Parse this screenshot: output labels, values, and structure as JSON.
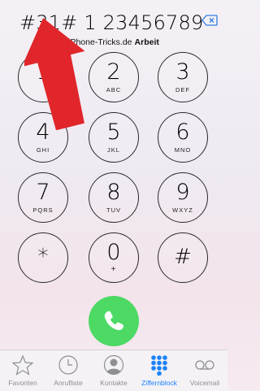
{
  "dialer": {
    "number": "#31# 1 23456789",
    "caller_name": "iPhone-Tricks.de",
    "caller_tag": "Arbeit"
  },
  "keys": [
    {
      "digit": "1",
      "letters": ""
    },
    {
      "digit": "2",
      "letters": "ABC"
    },
    {
      "digit": "3",
      "letters": "DEF"
    },
    {
      "digit": "4",
      "letters": "GHI"
    },
    {
      "digit": "5",
      "letters": "JKL"
    },
    {
      "digit": "6",
      "letters": "MNO"
    },
    {
      "digit": "7",
      "letters": "PQRS"
    },
    {
      "digit": "8",
      "letters": "TUV"
    },
    {
      "digit": "9",
      "letters": "WXYZ"
    },
    {
      "digit": "*",
      "letters": ""
    },
    {
      "digit": "0",
      "letters": "+"
    },
    {
      "digit": "#",
      "letters": ""
    }
  ],
  "tabbar": {
    "items": [
      {
        "label": "Favoriten",
        "icon": "star-icon",
        "active": false
      },
      {
        "label": "Anrufliste",
        "icon": "clock-icon",
        "active": false
      },
      {
        "label": "Kontakte",
        "icon": "person-icon",
        "active": false
      },
      {
        "label": "Ziffernblock",
        "icon": "keypad-icon",
        "active": true
      },
      {
        "label": "Voicemail",
        "icon": "voicemail-icon",
        "active": false
      }
    ]
  },
  "colors": {
    "accent": "#1a82fb",
    "call_button": "#4cd964",
    "annotation_arrow": "#e0262a",
    "inactive_tab": "#8e8e93"
  }
}
